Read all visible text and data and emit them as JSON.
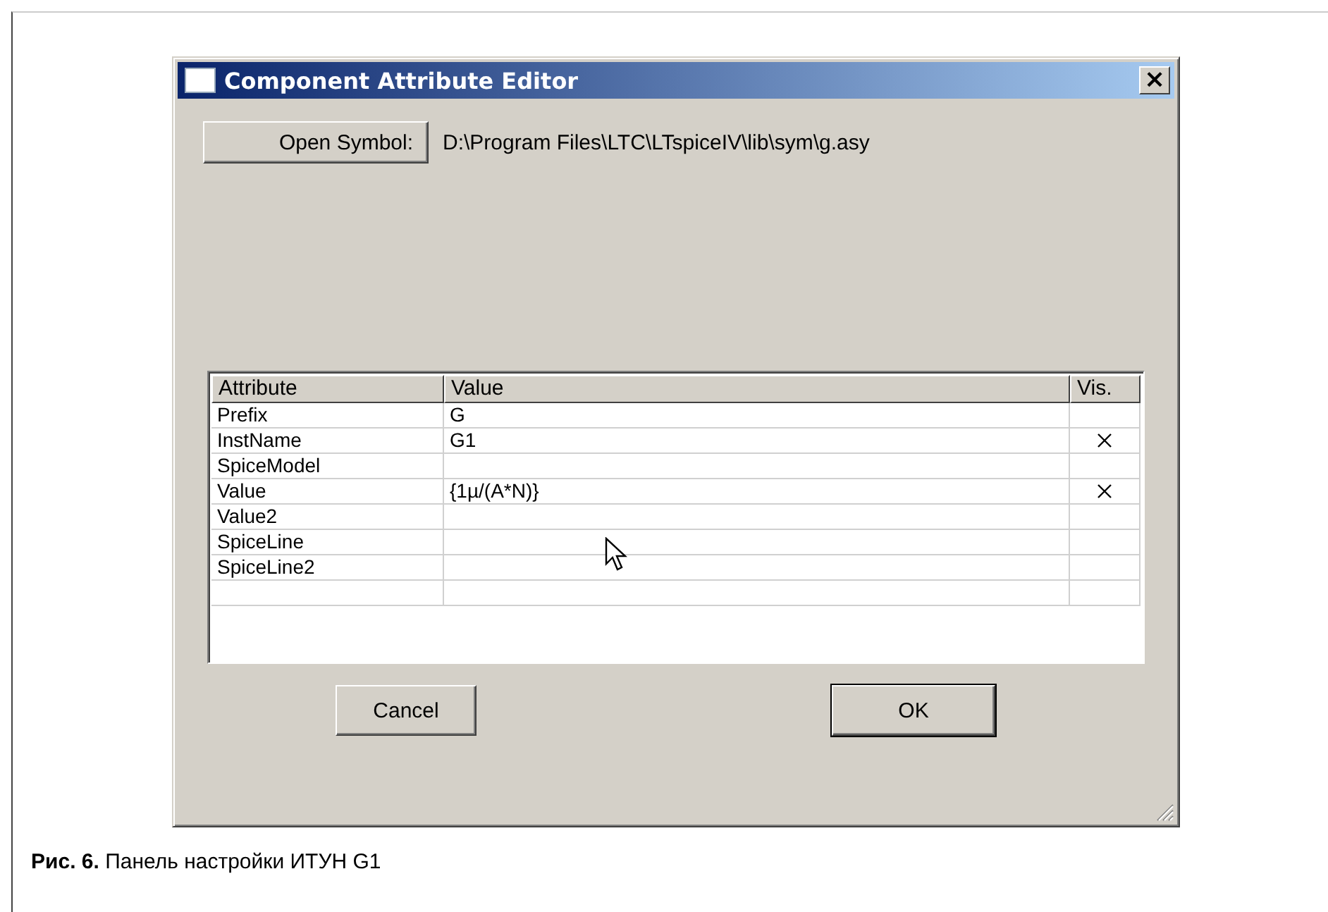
{
  "window": {
    "title": "Component Attribute Editor",
    "close_button": "×"
  },
  "open_symbol": {
    "button": "Open Symbol:",
    "path": "D:\\Program Files\\LTC\\LTspiceIV\\lib\\sym\\g.asy"
  },
  "table": {
    "columns": [
      "Attribute",
      "Value",
      "Vis."
    ],
    "rows": [
      {
        "attribute": "Prefix",
        "value": "G",
        "visible": false
      },
      {
        "attribute": "InstName",
        "value": "G1",
        "visible": true
      },
      {
        "attribute": "SpiceModel",
        "value": "",
        "visible": false
      },
      {
        "attribute": "Value",
        "value": "{1µ/(A*N)}",
        "visible": true
      },
      {
        "attribute": "Value2",
        "value": "",
        "visible": false
      },
      {
        "attribute": "SpiceLine",
        "value": "",
        "visible": false
      },
      {
        "attribute": "SpiceLine2",
        "value": "",
        "visible": false
      }
    ]
  },
  "buttons": [
    {
      "label": "Cancel",
      "default": false
    },
    {
      "label": "OK",
      "default": true
    }
  ],
  "caption": "**Рис. 6.** Панель настройки ИТУН G1"
}
